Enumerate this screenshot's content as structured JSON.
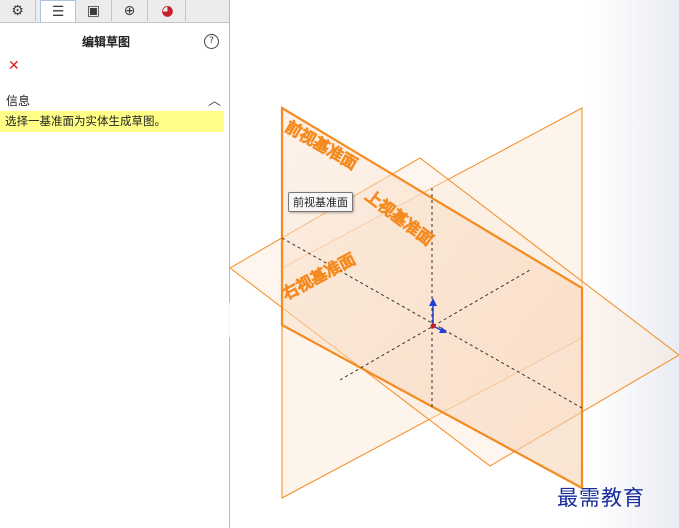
{
  "panel": {
    "tabs": [
      {
        "name": "feature-manager",
        "icon": "⚙"
      },
      {
        "name": "property-manager",
        "icon": "☰"
      },
      {
        "name": "configuration-manager",
        "icon": "▣"
      },
      {
        "name": "dimxpert-manager",
        "icon": "⊕"
      },
      {
        "name": "display-manager",
        "icon": "◕"
      }
    ],
    "title": "编辑草图",
    "help_icon": "?",
    "close_icon": "✕",
    "info_label": "信息",
    "collapse_icon": "︿",
    "message": "选择一基准面为实体生成草图。"
  },
  "viewport": {
    "plane_labels": {
      "front": "前视基准面",
      "top": "上视基准面",
      "right": "右视基准面"
    },
    "tooltip": "前视基准面",
    "plane_color": "#f58a1f"
  },
  "watermark": "最需教育"
}
